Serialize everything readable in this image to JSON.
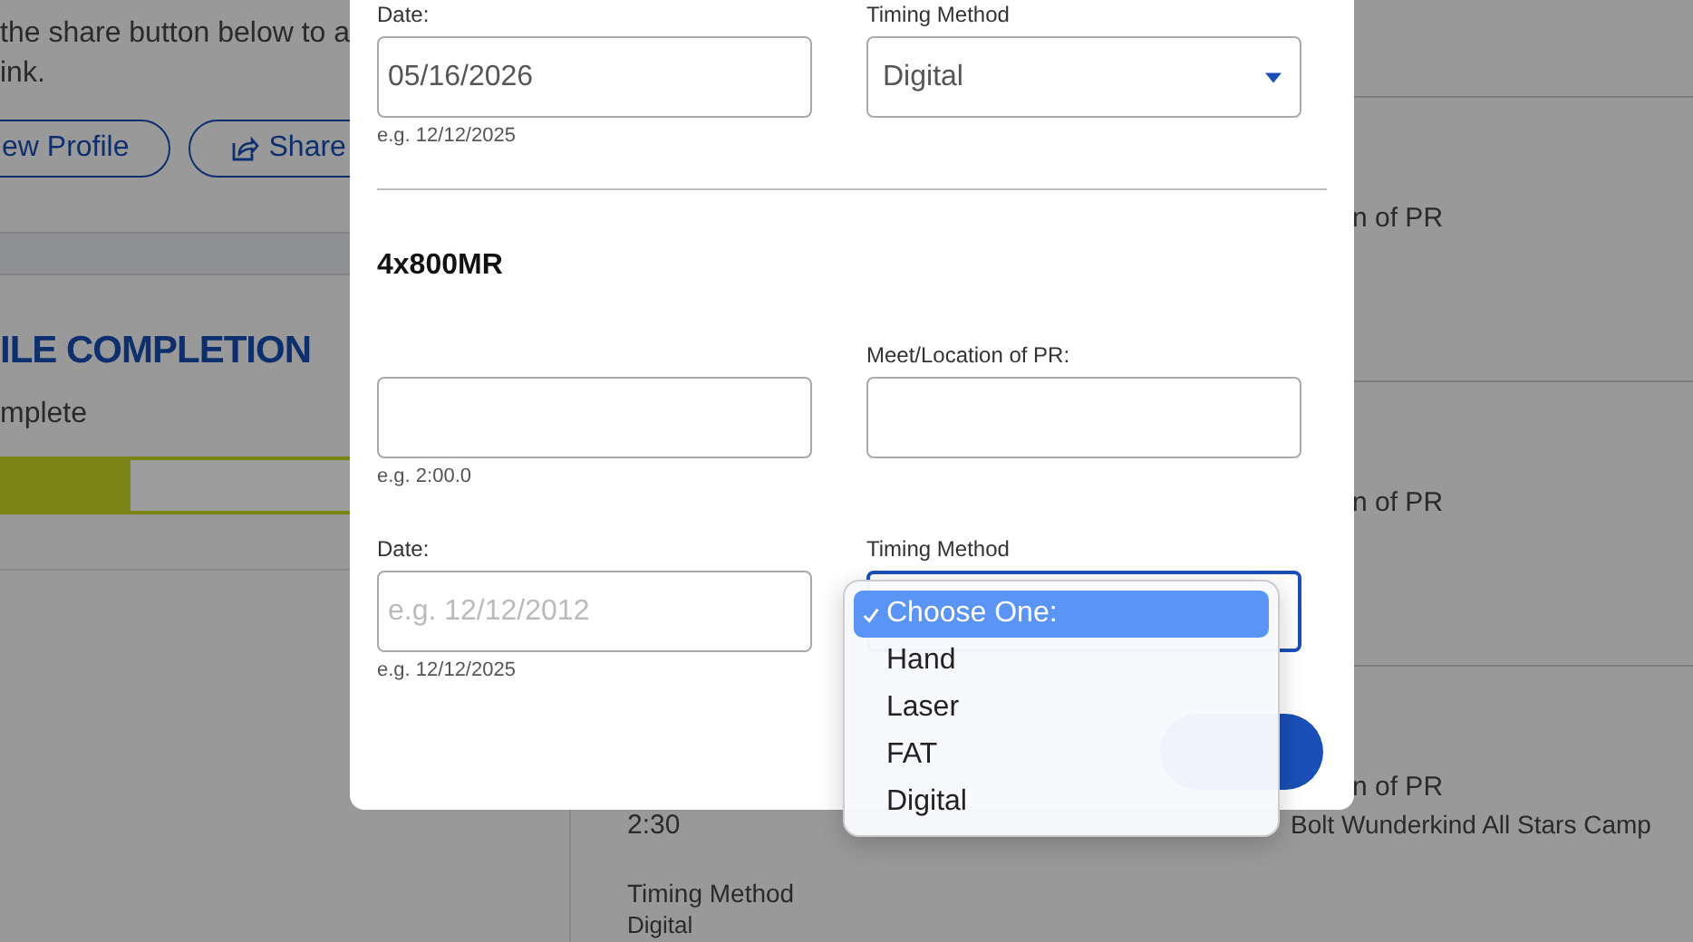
{
  "background": {
    "intro_lines": [
      "the share button below to a",
      "ink."
    ],
    "buttons": [
      {
        "label": "ew Profile",
        "kind": "plain"
      },
      {
        "label": "Share",
        "kind": "share"
      }
    ],
    "completion": {
      "title": "ILE COMPLETION",
      "status": "mplete",
      "level": 0.24
    },
    "rows": [
      {
        "label": "n of PR"
      },
      {
        "label": "n of PR"
      },
      {
        "label": "n of PR",
        "meet": "Bolt Wunderkind All Stars Camp",
        "time": "2:30",
        "timing_label": "Timing Method",
        "timing_value": "Digital"
      }
    ]
  },
  "modal": {
    "sections": [
      {
        "fields": [
          {
            "kind": "input",
            "label": "Date:",
            "value": "05/16/2026",
            "hint": "e.g. 12/12/2025"
          },
          {
            "kind": "select",
            "label": "Timing Method",
            "value": "Digital",
            "open": false
          }
        ]
      },
      {
        "title": "4x800MR",
        "fields": [
          {
            "kind": "input",
            "hint": "e.g. 2:00.0"
          },
          {
            "kind": "input",
            "label": "Meet/Location of PR:"
          }
        ]
      },
      {
        "fields": [
          {
            "kind": "input",
            "label": "Date:",
            "placeholder": "e.g. 12/12/2012",
            "hint": "e.g. 12/12/2025"
          },
          {
            "kind": "select",
            "label": "Timing Method",
            "open": true
          }
        ]
      }
    ],
    "options": [
      {
        "label": "Choose One:",
        "selected": true
      },
      {
        "label": "Hand",
        "selected": false
      },
      {
        "label": "Laser",
        "selected": false
      },
      {
        "label": "FAT",
        "selected": false
      },
      {
        "label": "Digital",
        "selected": false
      }
    ]
  }
}
